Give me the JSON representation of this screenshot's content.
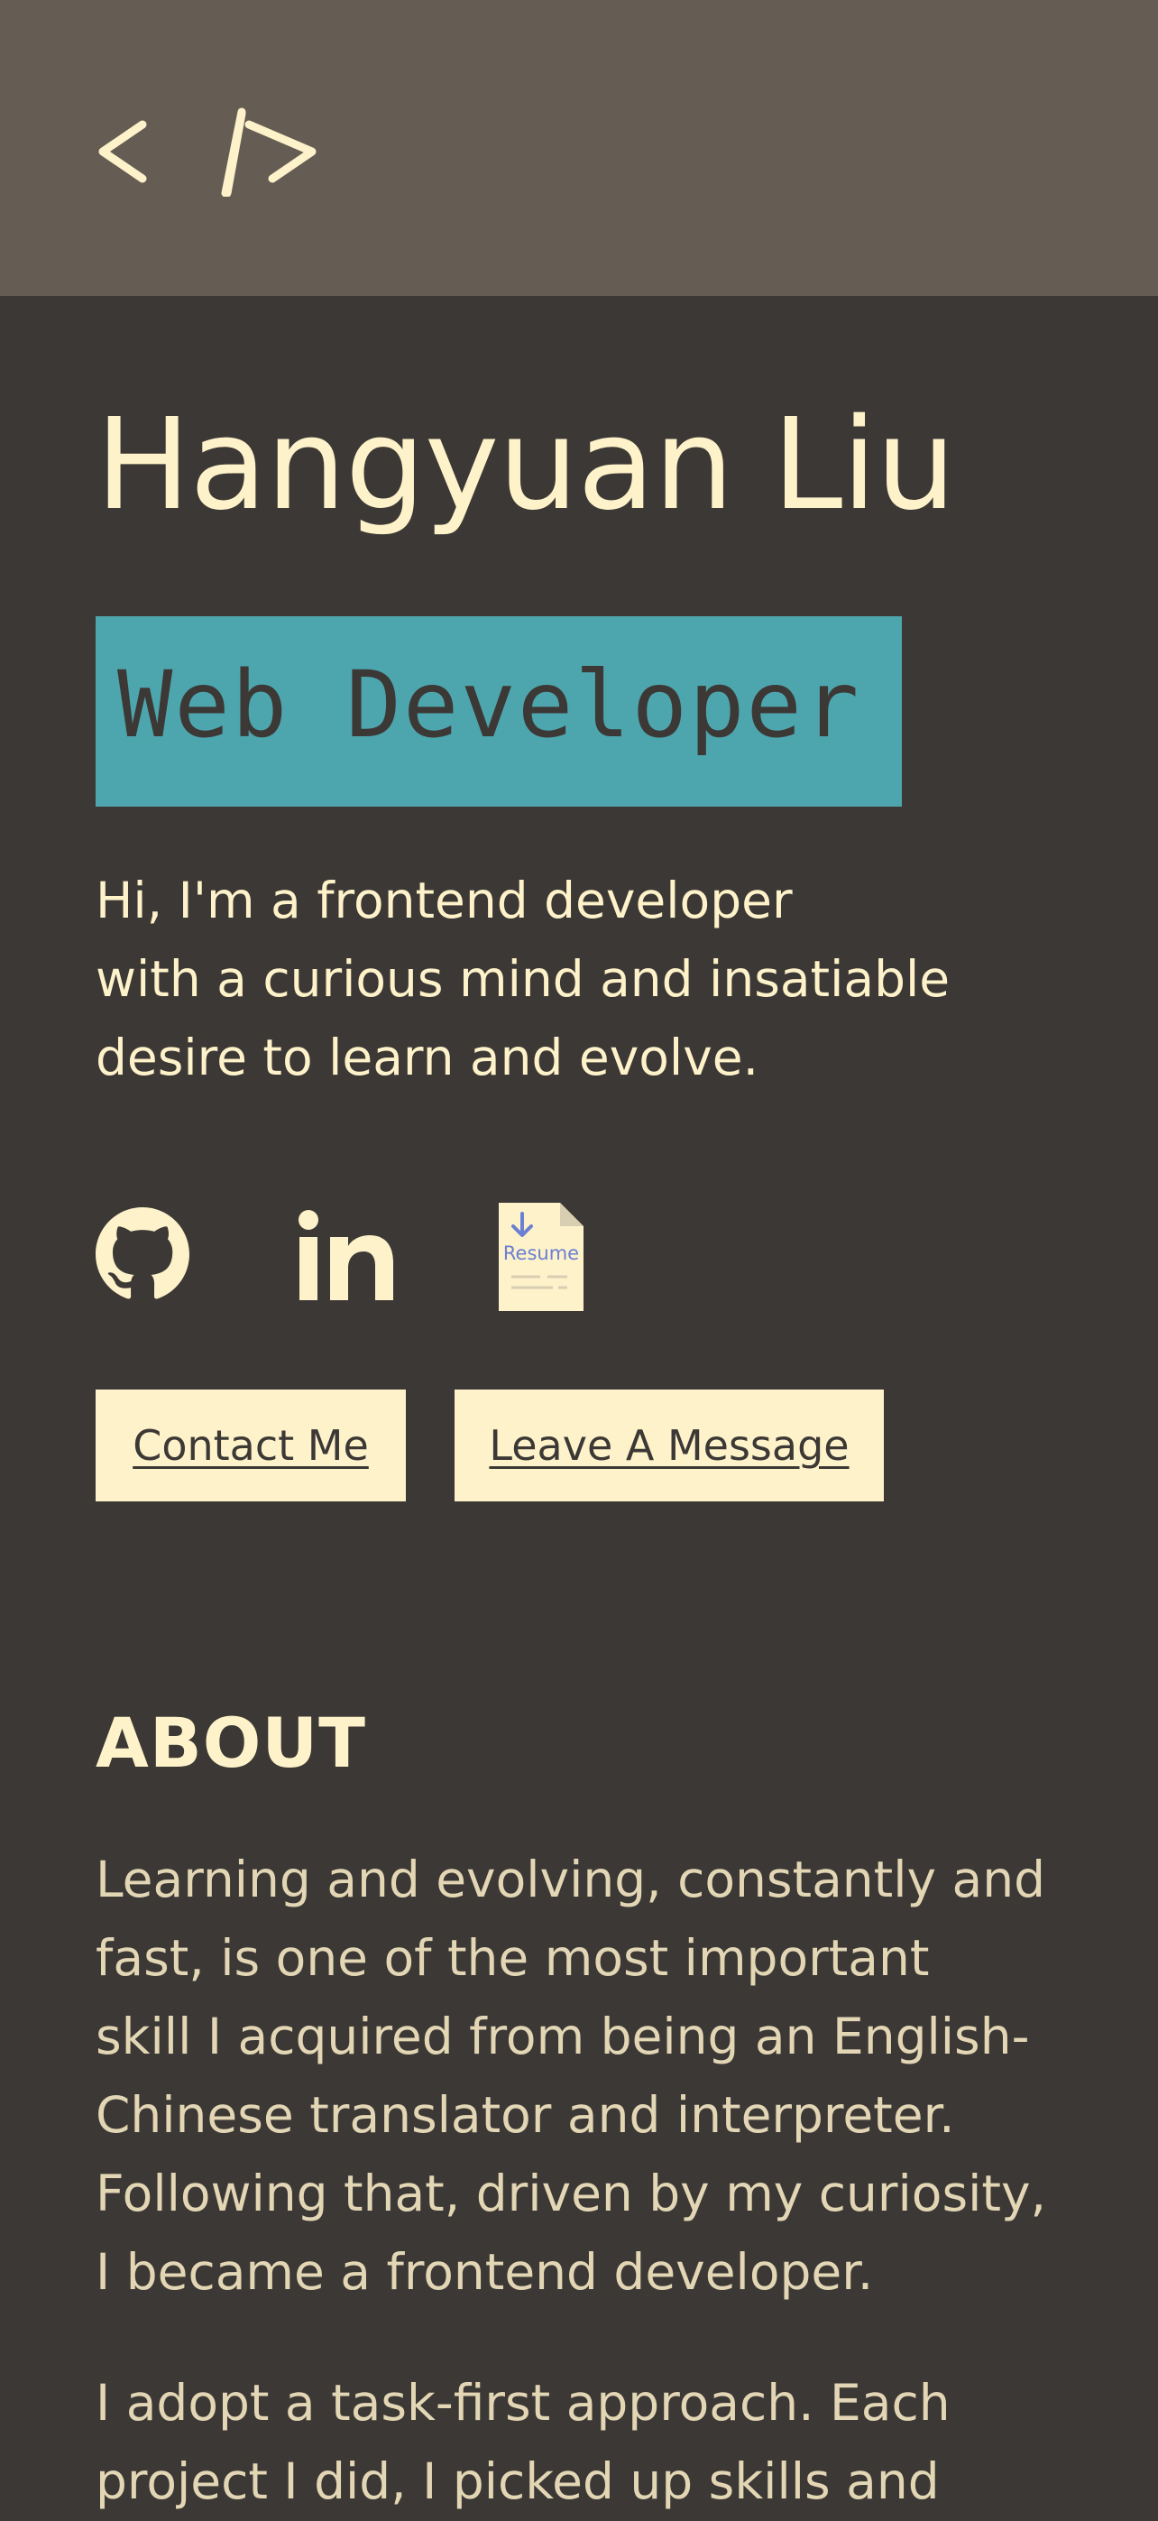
{
  "header": {
    "logo_icon": "code-brackets-icon"
  },
  "hero": {
    "name": "Hangyuan Liu",
    "role": "Web Developer",
    "intro_lines": [
      "Hi, I'm a frontend developer",
      "with a curious mind and insatiable",
      "desire to learn and evolve."
    ]
  },
  "socials": [
    {
      "name": "github-icon"
    },
    {
      "name": "linkedin-icon"
    },
    {
      "name": "resume-icon",
      "label": "Resume"
    }
  ],
  "buttons": {
    "contact": "Contact Me",
    "message": "Leave A Message"
  },
  "about": {
    "title": "ABOUT",
    "paragraph1": [
      "Learning and evolving, constantly and",
      "fast, is one of the most important",
      "skill I acquired from being an English-",
      "Chinese translator and interpreter.",
      "Following that, driven by my curiosity,",
      "I became a frontend developer."
    ],
    "paragraph2": [
      "I adopt a task-first approach. Each",
      "project I did, I picked up skills and"
    ]
  },
  "colors": {
    "header_bg": "#655c54",
    "page_bg": "#3c3835",
    "cream": "#fdf2c9",
    "teal": "#4da6ae",
    "resume_blue": "#6b7fd4"
  }
}
